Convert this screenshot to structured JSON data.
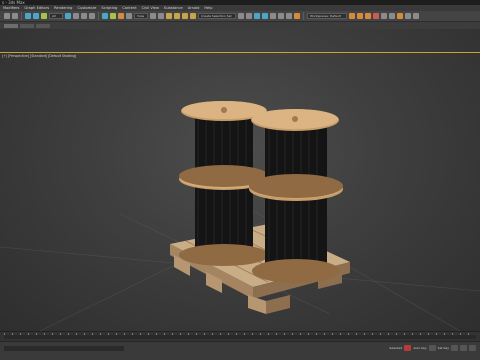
{
  "window": {
    "title": "s - 3ds Max"
  },
  "menu": {
    "items": [
      "Modifiers",
      "Graph Editors",
      "Rendering",
      "Customize",
      "Scripting",
      "Content",
      "Civil View",
      "Substance",
      "Arnold",
      "Help"
    ]
  },
  "toolbar": {
    "filter_label": "All",
    "view_label": "View",
    "selection_set_label": "Create Selection Set",
    "workspace_label": "Workspaces: Default"
  },
  "viewport": {
    "label": "[+] [Perspective] [Standard] [Default Shading]"
  },
  "status": {
    "selected_label": "Selected",
    "autokey_label": "Auto Key",
    "setkey_label": "Set Key"
  }
}
